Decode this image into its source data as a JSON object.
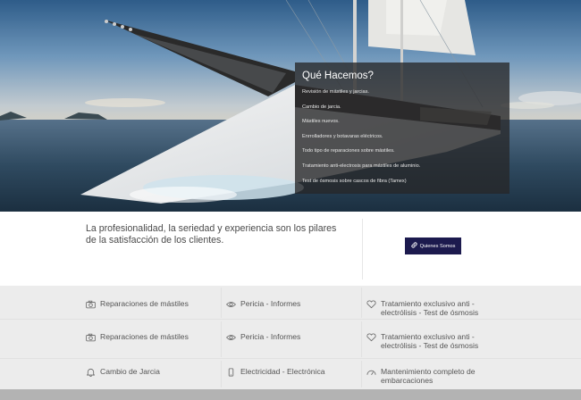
{
  "hero": {
    "panel": {
      "title": "Qué Hacemos?",
      "items": [
        "Revisión de mástiles y jarcias.",
        "Cambio de jarcia.",
        "Mástiles nuevos.",
        "Enrrolladores y botavaras eléctricos.",
        "Todo tipo de reparaciones sobre mástiles.",
        "Tratamiento anti-electrosis para mástiles de aluminio.",
        "Test de ósmosis sobre cascos de fibra (Tamex)"
      ]
    }
  },
  "intro": {
    "tagline": "La profesionalidad, la seriedad y experiencia son los pilares de la satisfacción de los clientes.",
    "button_label": "Quienes Somos",
    "button_icon": "link-icon",
    "button_color": "#1c1a4e"
  },
  "services": {
    "rows": [
      [
        {
          "icon": "camera-icon",
          "label": "Reparaciones de mástiles"
        },
        {
          "icon": "eye-icon",
          "label": "Pericia - Informes"
        },
        {
          "icon": "heart-icon",
          "label": "Tratamiento exclusivo anti - electrólisis - Test de ósmosis"
        }
      ],
      [
        {
          "icon": "camera-icon",
          "label": "Reparaciones de mástiles"
        },
        {
          "icon": "eye-icon",
          "label": "Pericia - Informes"
        },
        {
          "icon": "heart-icon",
          "label": "Tratamiento exclusivo anti - electrólisis - Test de ósmosis"
        }
      ],
      [
        {
          "icon": "bell-icon",
          "label": "Cambio de Jarcia"
        },
        {
          "icon": "mobile-icon",
          "label": "Electricidad - Electrónica"
        },
        {
          "icon": "gauge-icon",
          "label": "Mantenimiento completo de embarcaciones"
        }
      ]
    ]
  }
}
